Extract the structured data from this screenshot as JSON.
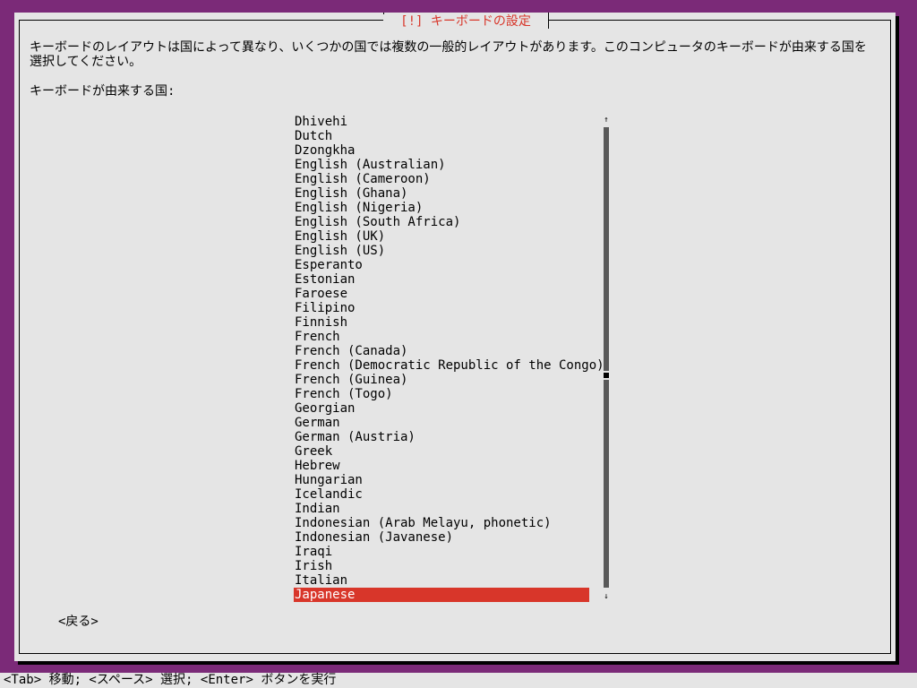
{
  "dialog": {
    "title": "[!] キーボードの設定",
    "description": "キーボードのレイアウトは国によって異なり、いくつかの国では複数の一般的レイアウトがあります。このコンピュータのキーボードが由来する国を選択してください。",
    "prompt": "キーボードが由来する国:"
  },
  "list": {
    "items": [
      "Dhivehi",
      "Dutch",
      "Dzongkha",
      "English (Australian)",
      "English (Cameroon)",
      "English (Ghana)",
      "English (Nigeria)",
      "English (South Africa)",
      "English (UK)",
      "English (US)",
      "Esperanto",
      "Estonian",
      "Faroese",
      "Filipino",
      "Finnish",
      "French",
      "French (Canada)",
      "French (Democratic Republic of the Congo)",
      "French (Guinea)",
      "French (Togo)",
      "Georgian",
      "German",
      "German (Austria)",
      "Greek",
      "Hebrew",
      "Hungarian",
      "Icelandic",
      "Indian",
      "Indonesian (Arab Melayu, phonetic)",
      "Indonesian (Javanese)",
      "Iraqi",
      "Irish",
      "Italian",
      "Japanese"
    ],
    "selected": "Japanese",
    "scroll_up_icon": "↑",
    "scroll_down_icon": "↓"
  },
  "buttons": {
    "back": "<戻る>"
  },
  "statusbar": {
    "text": "<Tab> 移動; <スペース> 選択; <Enter> ボタンを実行"
  },
  "colors": {
    "background": "#7b2a78",
    "dialog": "#e5e5e5",
    "accent": "#d8362a"
  }
}
